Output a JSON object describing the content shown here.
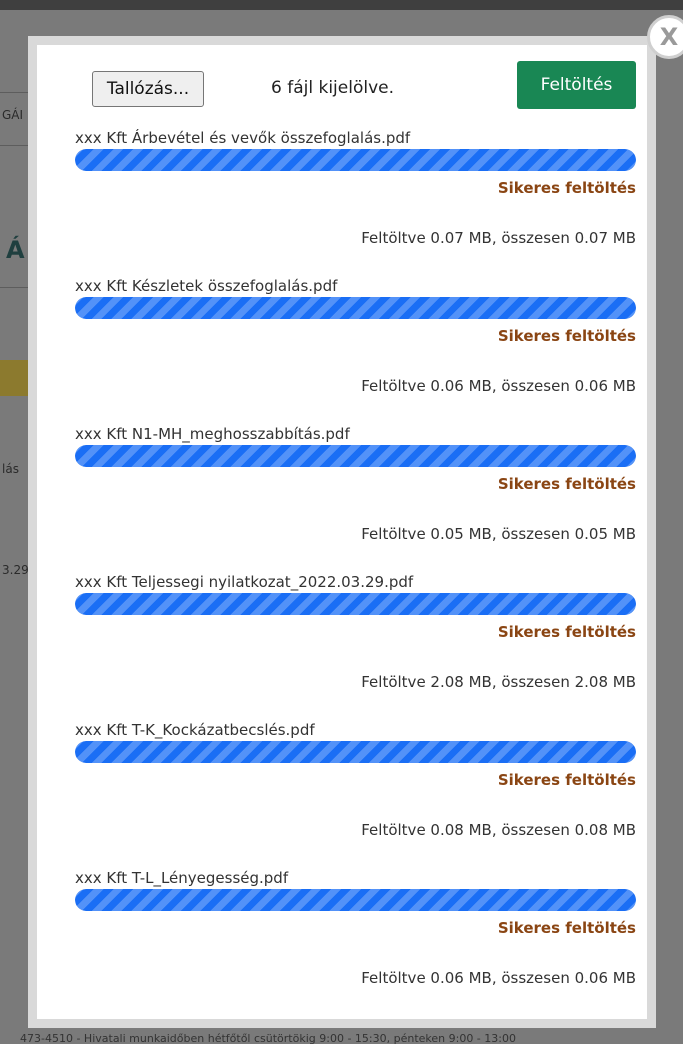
{
  "background": {
    "fragments": [
      "GÁI",
      "Á",
      "lás",
      "3.29",
      "473-4510 - Hivatali munkaidőben hétfőtől csütörtökig 9:00 - 15:30, pénteken 9:00 - 13:00"
    ]
  },
  "dialog": {
    "close_label": "X",
    "browse_label": "Tallózás...",
    "selected_text": "6 fájl kijelölve.",
    "upload_label": "Feltöltés"
  },
  "files": [
    {
      "name": "xxx Kft Árbevétel és vevők összefoglalás.pdf",
      "progress": 1.0,
      "status": "Sikeres feltöltés",
      "size_text": "Feltöltve 0.07 MB, összesen 0.07 MB"
    },
    {
      "name": "xxx Kft Készletek összefoglalás.pdf",
      "progress": 1.0,
      "status": "Sikeres feltöltés",
      "size_text": "Feltöltve 0.06 MB, összesen 0.06 MB"
    },
    {
      "name": "xxx Kft N1-MH_meghosszabbítás.pdf",
      "progress": 1.0,
      "status": "Sikeres feltöltés",
      "size_text": "Feltöltve 0.05 MB, összesen 0.05 MB"
    },
    {
      "name": "xxx Kft Teljessegi nyilatkozat_2022.03.29.pdf",
      "progress": 1.0,
      "status": "Sikeres feltöltés",
      "size_text": "Feltöltve 2.08 MB, összesen 2.08 MB"
    },
    {
      "name": "xxx Kft T-K_Kockázatbecslés.pdf",
      "progress": 1.0,
      "status": "Sikeres feltöltés",
      "size_text": "Feltöltve 0.08 MB, összesen 0.08 MB"
    },
    {
      "name": "xxx Kft T-L_Lényegesség.pdf",
      "progress": 1.0,
      "status": "Sikeres feltöltés",
      "size_text": "Feltöltve 0.06 MB, összesen 0.06 MB"
    }
  ],
  "colors": {
    "upload_button": "#198754",
    "progress_bar": "#1a6ef5",
    "status_text": "#8a4513"
  },
  "icons": {
    "close": "close-icon"
  }
}
